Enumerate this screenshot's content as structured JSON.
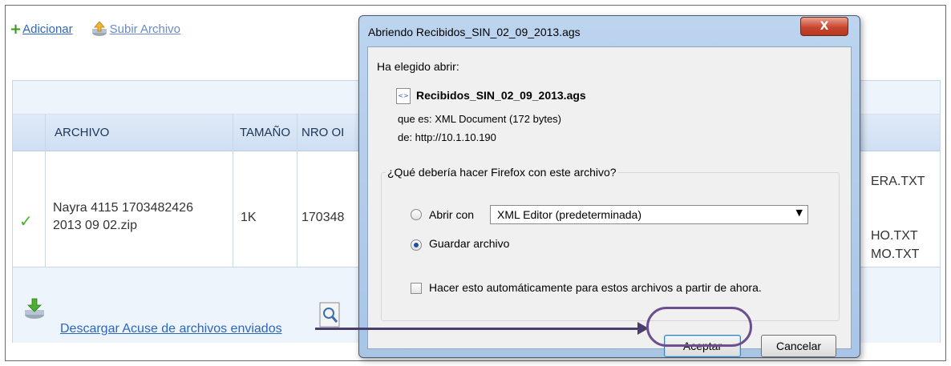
{
  "toolbar": {
    "add_label": "Adicionar",
    "upload_label": "Subir Archivo"
  },
  "table": {
    "columns": [
      "ARCHIVO",
      "TAMAÑO",
      "NRO OI"
    ],
    "row": {
      "archivo_line1": "Nayra 4115 1703482426",
      "archivo_line2": "2013 09 02.zip",
      "tamano": "1K",
      "nro": "170348"
    },
    "right_fragments": [
      "ERA.TXT",
      "HO.TXT",
      "MO.TXT"
    ]
  },
  "footer": {
    "download_label": "Descargar Acuse de archivos enviados"
  },
  "dialog": {
    "title": "Abriendo Recibidos_SIN_02_09_2013.ags",
    "close_label": "X",
    "chosen_label": "Ha elegido abrir:",
    "file_name": "Recibidos_SIN_02_09_2013.ags",
    "type_line": "que es:  XML Document (172 bytes)",
    "from_line": "de:  http://10.1.10.190",
    "question": "¿Qué debería hacer Firefox con este archivo?",
    "open_with_label": "Abrir con",
    "open_with_app": "XML Editor (predeterminada)",
    "save_label": "Guardar archivo",
    "auto_label": "Hacer esto automáticamente para estos archivos a partir de ahora.",
    "accept_label": "Aceptar",
    "cancel_label": "Cancelar",
    "selected_option": "save"
  }
}
